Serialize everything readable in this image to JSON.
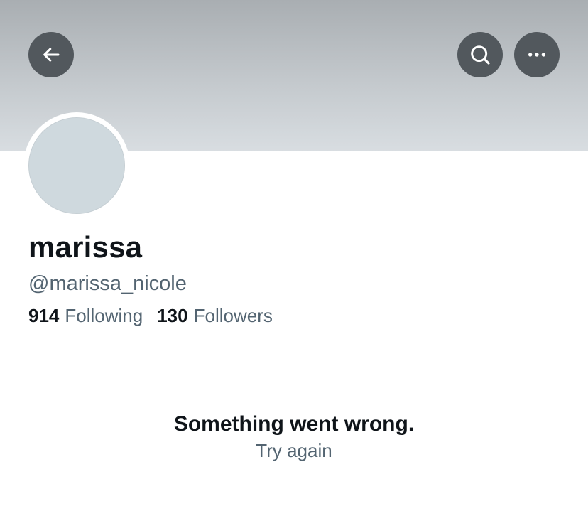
{
  "header": {
    "back_icon": "arrow-left-icon",
    "search_icon": "search-icon",
    "more_icon": "more-dots-icon"
  },
  "profile": {
    "display_name": "marissa",
    "handle": "@marissa_nicole",
    "following_count": "914",
    "following_label": "Following",
    "followers_count": "130",
    "followers_label": "Followers"
  },
  "error": {
    "title": "Something went wrong.",
    "retry_label": "Try again"
  },
  "colors": {
    "text_primary": "#0f1419",
    "text_secondary": "#536471",
    "button_bg": "#52585d",
    "avatar_placeholder": "#cfd9de"
  }
}
